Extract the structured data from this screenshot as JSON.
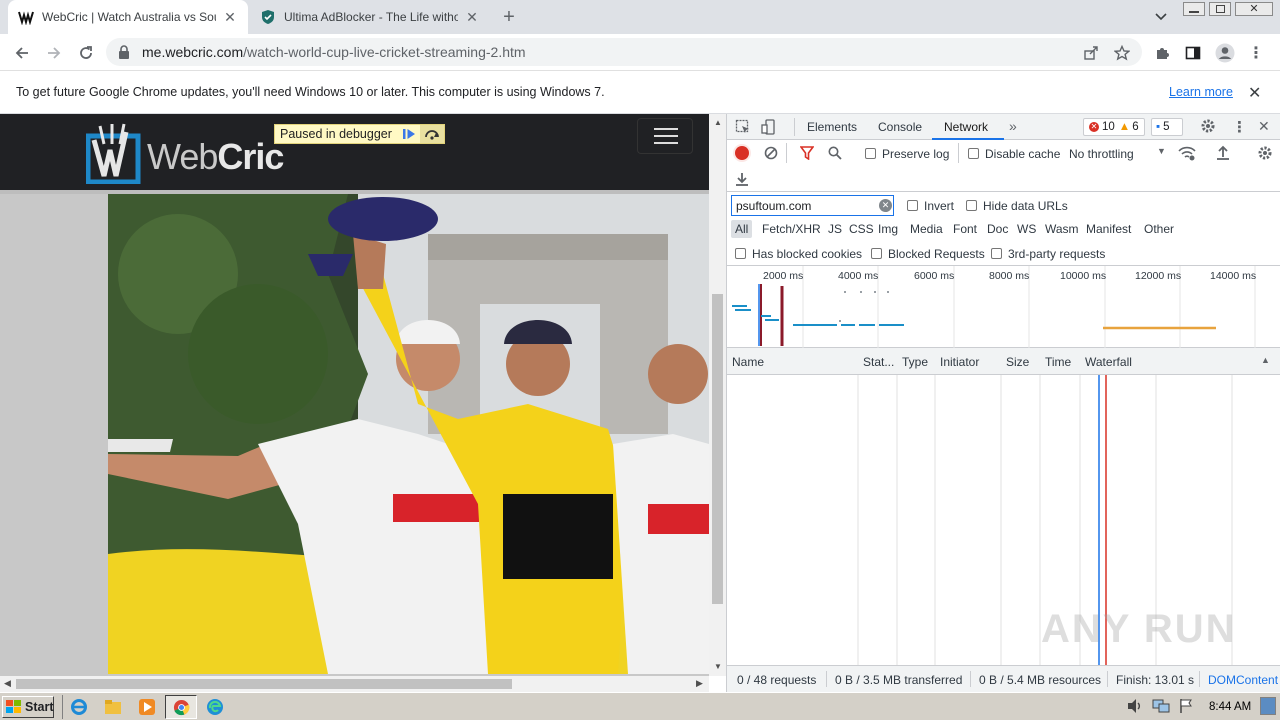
{
  "browser": {
    "tabs": [
      {
        "title": "WebCric | Watch Australia vs South",
        "icon": "webcric-favicon",
        "active": true
      },
      {
        "title": "Ultima AdBlocker - The Life without A",
        "icon": "shield-icon",
        "active": false
      }
    ],
    "url_host": "me.webcric.com",
    "url_path": "/watch-world-cup-live-cricket-streaming-2.htm"
  },
  "infobar": {
    "message": "To get future Google Chrome updates, you'll need Windows 10 or later. This computer is using Windows 7.",
    "link": "Learn more"
  },
  "page": {
    "logo_text_a": "Web",
    "logo_text_b": "Cric",
    "debugger_label": "Paused in debugger"
  },
  "devtools": {
    "tabs": [
      "Elements",
      "Console",
      "Network"
    ],
    "active_tab": "Network",
    "errors": "10",
    "warnings": "6",
    "messages": "5",
    "preserve_log": "Preserve log",
    "disable_cache": "Disable cache",
    "throttling": "No throttling",
    "filter_value": "psuftoum.com",
    "invert": "Invert",
    "hide_data_urls": "Hide data URLs",
    "type_filters": [
      "All",
      "Fetch/XHR",
      "JS",
      "CSS",
      "Img",
      "Media",
      "Font",
      "Doc",
      "WS",
      "Wasm",
      "Manifest",
      "Other"
    ],
    "has_blocked_cookies": "Has blocked cookies",
    "blocked_requests": "Blocked Requests",
    "third_party": "3rd-party requests",
    "timeline_ticks": [
      "2000 ms",
      "4000 ms",
      "6000 ms",
      "8000 ms",
      "10000 ms",
      "12000 ms",
      "14000 ms"
    ],
    "columns": [
      "Name",
      "Stat...",
      "Type",
      "Initiator",
      "Size",
      "Time",
      "Waterfall"
    ],
    "status": {
      "requests": "0 / 48 requests",
      "transferred": "0 B / 3.5 MB transferred",
      "resources": "0 B / 5.4 MB resources",
      "finish": "Finish: 13.01 s",
      "domcontent": "DOMContent"
    }
  },
  "watermark": "ANY RUN",
  "taskbar": {
    "start": "Start",
    "clock": "8:44 AM"
  },
  "colors": {
    "tabstrip": "#dee1e6",
    "devtools_accent": "#1a73e8",
    "webcric_blue": "#1e88c8",
    "jersey_yellow": "#f4d21a"
  }
}
